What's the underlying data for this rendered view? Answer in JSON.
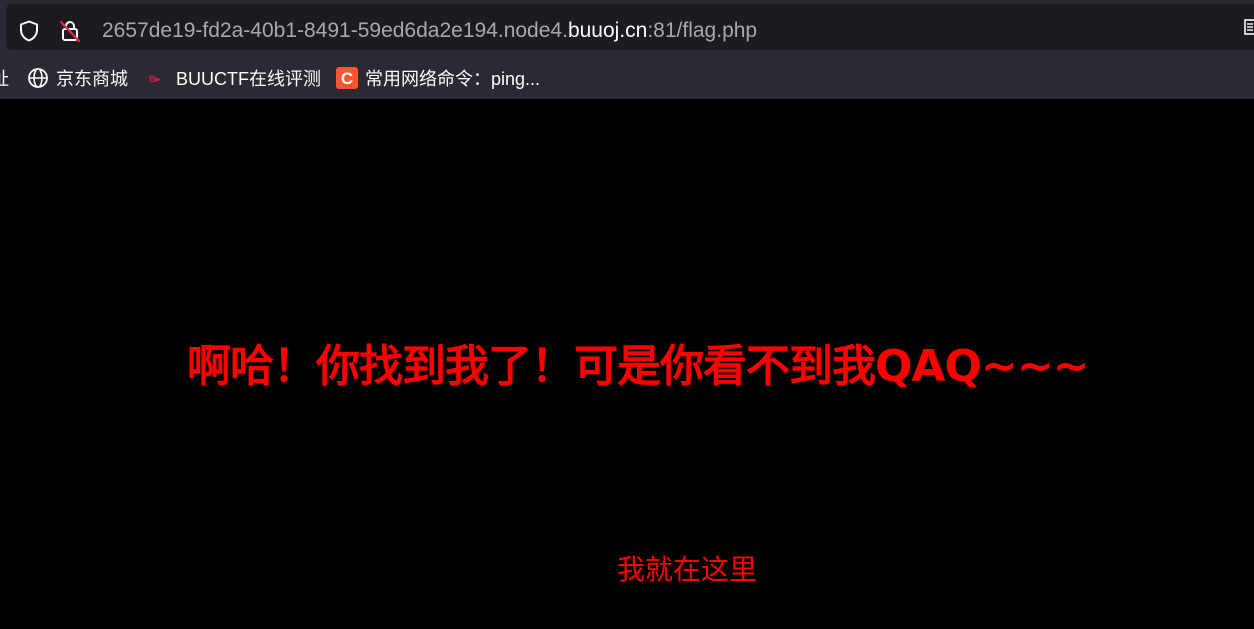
{
  "browser": {
    "url": {
      "prefix": "2657de19-fd2a-40b1-8491-59ed6da2e194.node4.",
      "host": "buuoj.cn",
      "suffix": ":81/flag.php"
    },
    "icons": {
      "shield": "shield-icon",
      "lock_insecure": "insecure-lock-icon"
    },
    "bookmarks": [
      {
        "label": "址",
        "icon": "none"
      },
      {
        "label": "京东商城",
        "icon": "globe-icon"
      },
      {
        "label": "BUUCTF在线评测",
        "icon": "buuctf-favicon"
      },
      {
        "label": "常用网络命令：ping...",
        "icon": "csdn-c-icon"
      }
    ]
  },
  "page": {
    "headline": "啊哈！你找到我了！可是你看不到我QAQ~~~",
    "hidden_note": "我就在这里",
    "text_color": "#ff0000",
    "background_color": "#000000"
  }
}
